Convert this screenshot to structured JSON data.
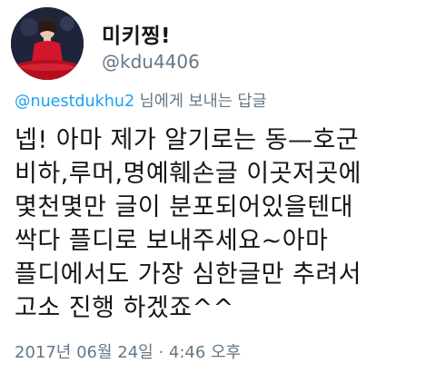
{
  "profile": {
    "display_name": "미키찡!",
    "handle": "@kdu4406"
  },
  "reply": {
    "mention": "@nuestdukhu2",
    "suffix": " 님에게 보내는 답글"
  },
  "tweet": {
    "lines": [
      "넵! 아마 제가 알기로는 동—호군",
      "비하,루머,명예훼손글 이곳저곳에",
      "몇천몇만 글이 분포되어있을텐대",
      "싹다 플디로 보내주세요~아마",
      "플디에서도 가장 심한글만 추려서",
      "고소 진행 하겠죠^^"
    ]
  },
  "meta": {
    "timestamp": "2017년 06월 24일 · 4:46 오후"
  },
  "colors": {
    "accent": "#1da1f2",
    "secondary_text": "#657786",
    "primary_text": "#14171a"
  }
}
